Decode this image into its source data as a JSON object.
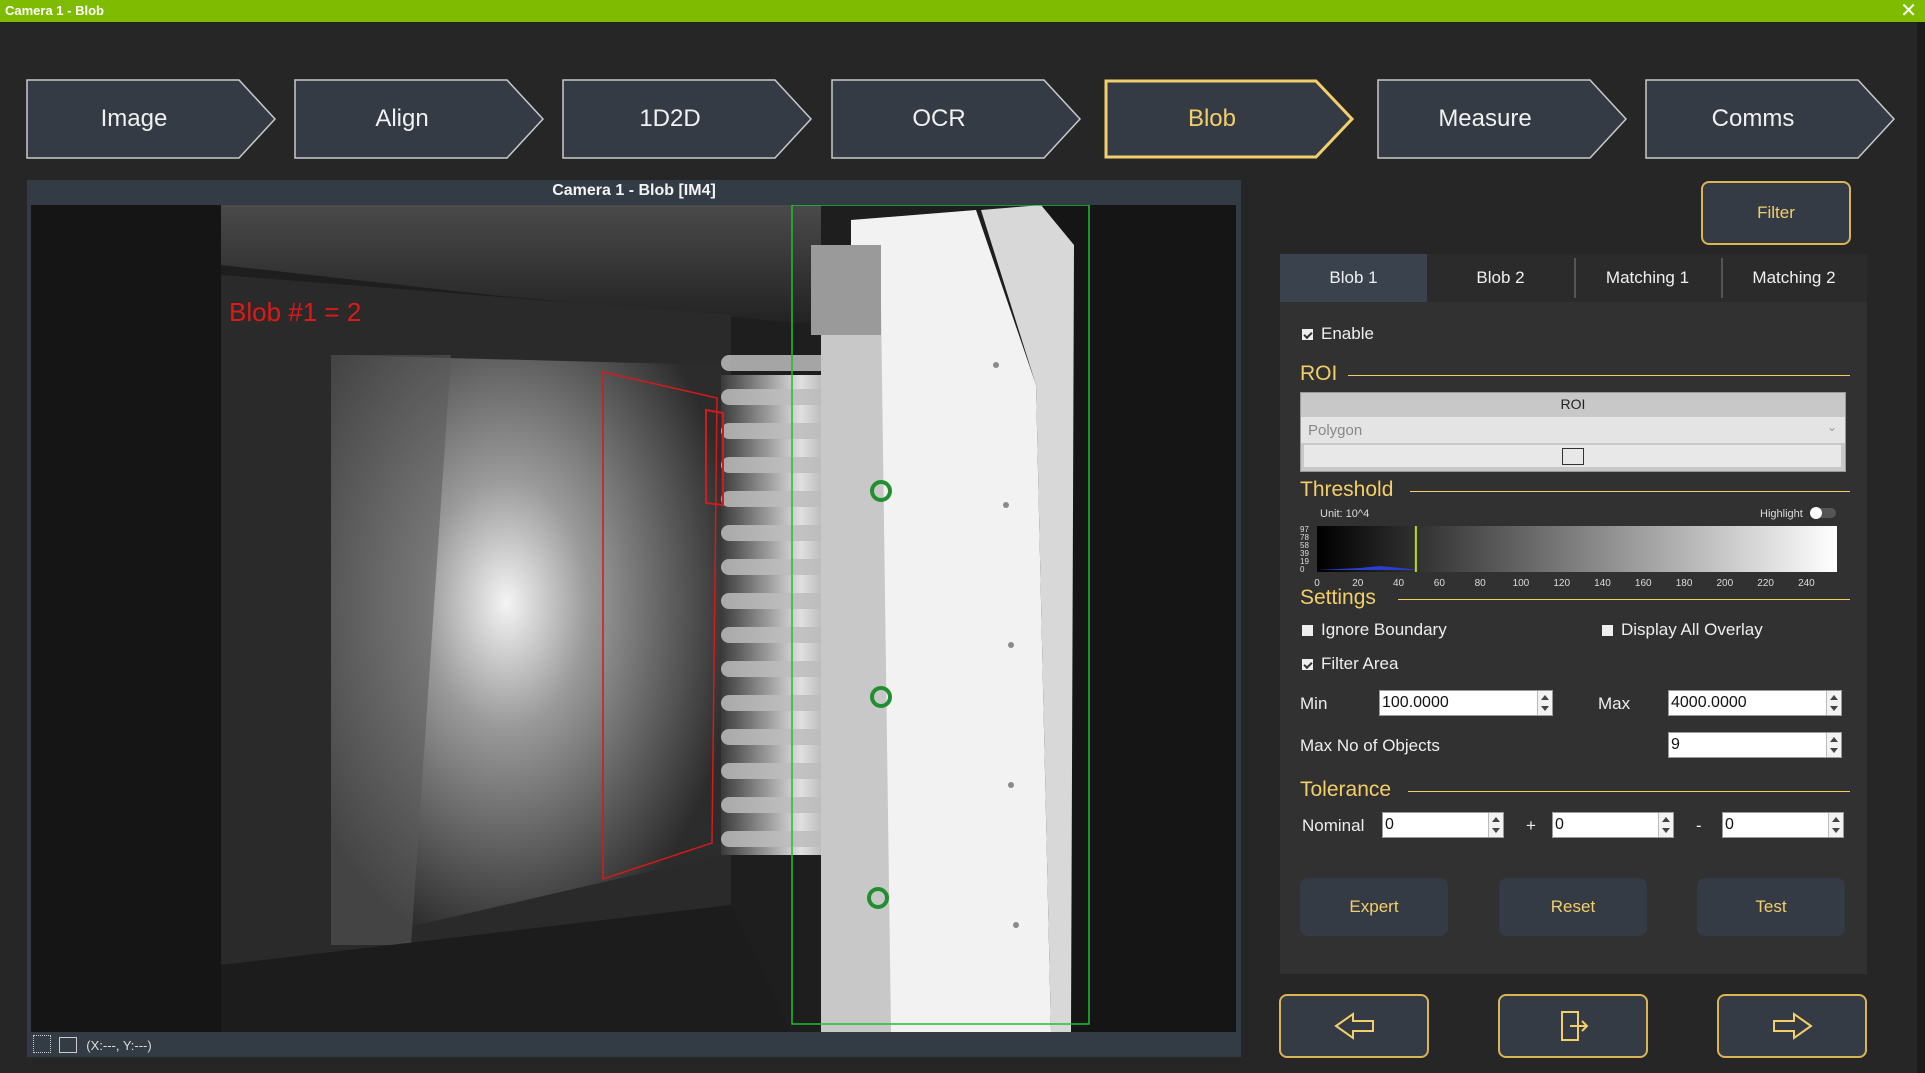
{
  "window": {
    "title": "Camera 1 - Blob"
  },
  "steps": [
    {
      "label": "Image"
    },
    {
      "label": "Align"
    },
    {
      "label": "1D2D"
    },
    {
      "label": "OCR"
    },
    {
      "label": "Blob"
    },
    {
      "label": "Measure"
    },
    {
      "label": "Comms"
    }
  ],
  "view": {
    "title": "Camera 1 - Blob  [IM4]",
    "overlay_text": "Blob #1 = 2",
    "coords": "(X:---, Y:---)"
  },
  "filter_button": "Filter",
  "tabs": [
    "Blob 1",
    "Blob 2",
    "Matching 1",
    "Matching 2"
  ],
  "enable_label": "Enable",
  "roi": {
    "section": "ROI",
    "header": "ROI",
    "shape": "Polygon"
  },
  "threshold": {
    "section": "Threshold",
    "unit": "Unit: 10^4",
    "highlight_label": "Highlight",
    "y_ticks": [
      "97",
      "78",
      "58",
      "39",
      "19",
      "0"
    ],
    "x_ticks": [
      "0",
      "20",
      "40",
      "60",
      "80",
      "100",
      "120",
      "140",
      "160",
      "180",
      "200",
      "220",
      "240"
    ],
    "value": 48
  },
  "settings": {
    "section": "Settings",
    "ignore_boundary": "Ignore Boundary",
    "display_all_overlay": "Display All Overlay",
    "filter_area": "Filter Area",
    "min_label": "Min",
    "min_value": "100.0000",
    "max_label": "Max",
    "max_value": "4000.0000",
    "max_objects_label": "Max No of Objects",
    "max_objects_value": "9"
  },
  "tolerance": {
    "section": "Tolerance",
    "nominal_label": "Nominal",
    "nominal_value": "0",
    "plus_label": "+",
    "plus_value": "0",
    "minus_label": "-",
    "minus_value": "0"
  },
  "actions": {
    "expert": "Expert",
    "reset": "Reset",
    "test": "Test"
  },
  "colors": {
    "accent": "#f2cf6a",
    "titlebar": "#7fbb00",
    "button": "#343b45"
  }
}
